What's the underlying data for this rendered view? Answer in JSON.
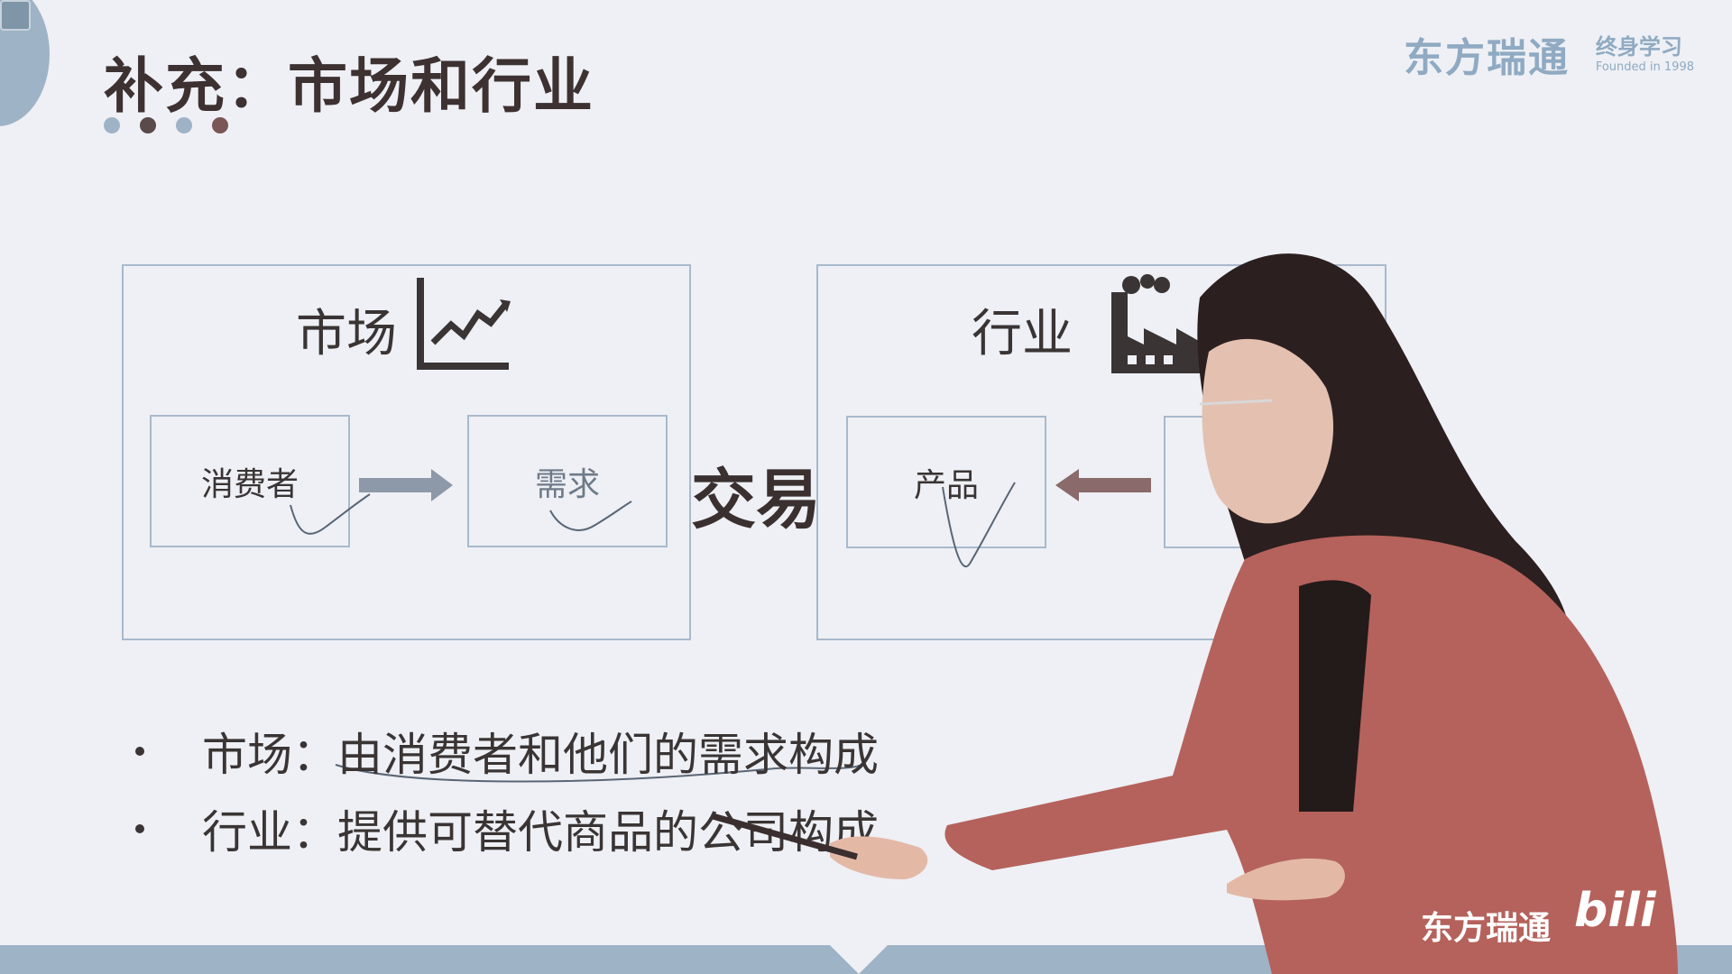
{
  "slide": {
    "title": "补充：市场和行业",
    "brand": "东方瑞通",
    "brand_sub_title": "终身学习",
    "brand_sub_year": "Founded in 1998",
    "trade_label": "交易"
  },
  "market": {
    "heading": "市场",
    "consumer_label": "消费者",
    "demand_label": "需求"
  },
  "industry": {
    "heading": "行业",
    "product_label": "产品"
  },
  "bullets": [
    {
      "text": "市场：由消费者和他们的需求构成"
    },
    {
      "text": "行业：提供可替代商品的公司构成"
    }
  ],
  "watermark": {
    "text": "东方瑞通",
    "site": "bili"
  },
  "colors": {
    "accent": "#9fb3c6",
    "dark": "#3a3434",
    "box_border": "#a9b9cc",
    "jacket": "#b5625c"
  }
}
